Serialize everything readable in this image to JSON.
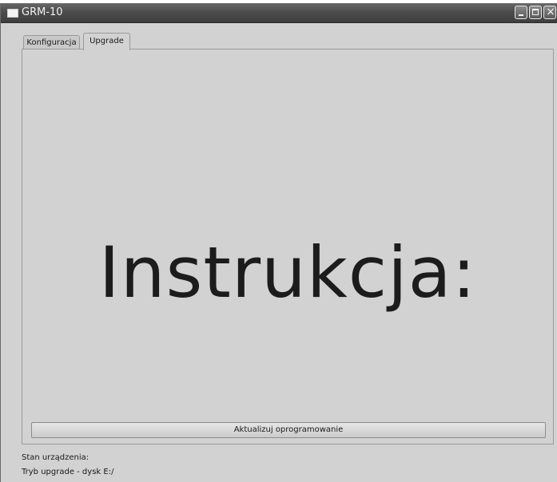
{
  "window": {
    "title": "GRM-10",
    "controls": {
      "minimize": "minimize",
      "maximize": "maximize",
      "close": "×"
    }
  },
  "tabs": [
    {
      "label": "Konfiguracja",
      "active": false
    },
    {
      "label": "Upgrade",
      "active": true
    }
  ],
  "upgrade_panel": {
    "heading": "Instrukcja:",
    "action_button": "Aktualizuj oprogramowanie"
  },
  "status": {
    "label": "Stan urządzenia:",
    "value": "Tryb upgrade - dysk E:/"
  },
  "icons": {
    "app": "window-app-icon",
    "minimize": "minimize-icon",
    "maximize": "maximize-icon",
    "close": "close-icon"
  }
}
